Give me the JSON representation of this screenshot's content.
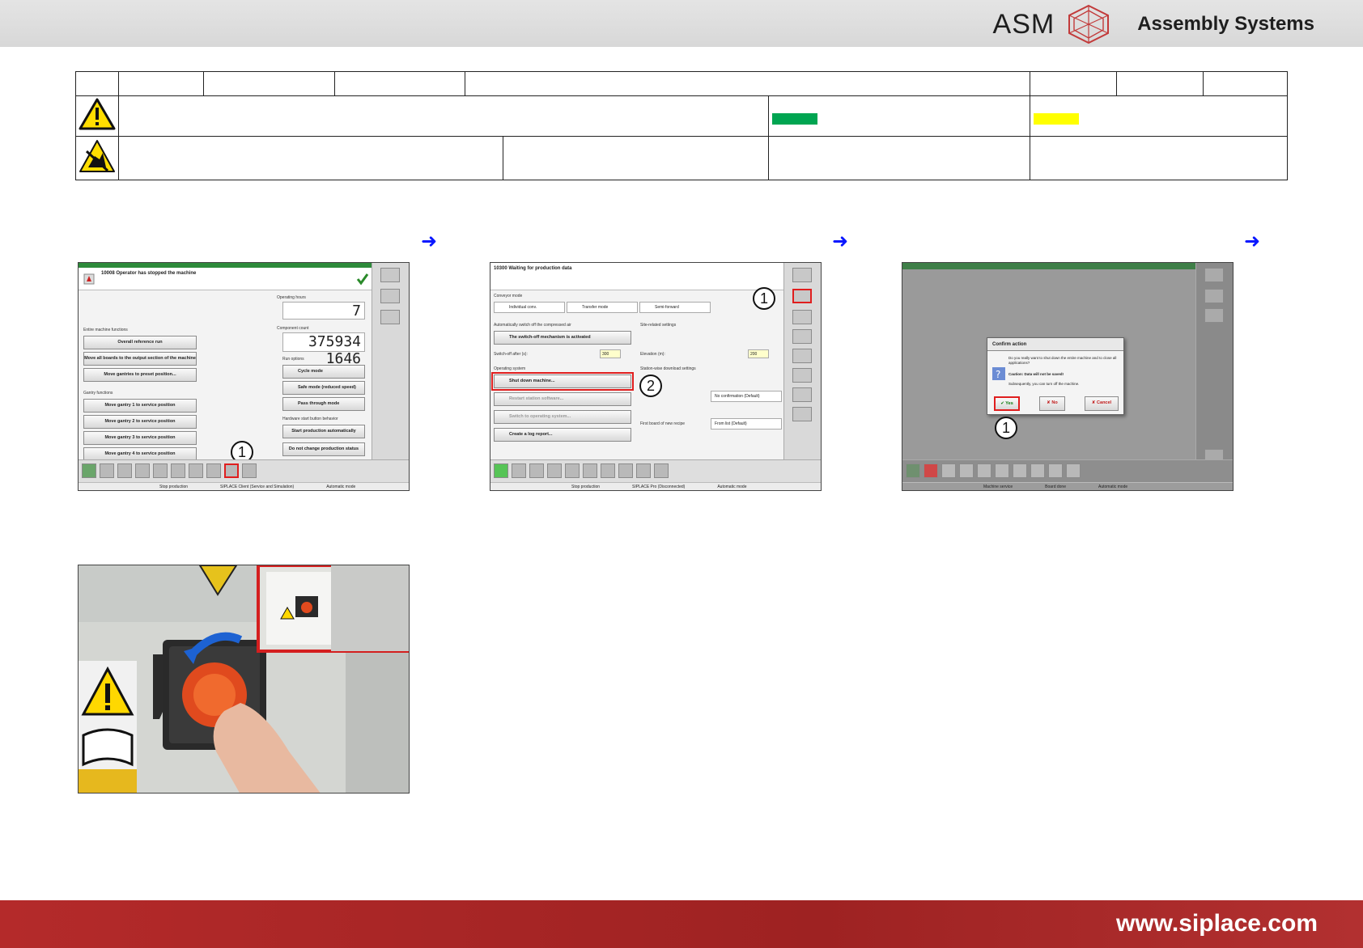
{
  "header": {
    "logo_text": "ASM",
    "logo_subtitle": "Assembly Systems"
  },
  "colors": {
    "green_swatch": "#00a551",
    "yellow_swatch": "#ffff00",
    "footer_red": "#a82626",
    "arrow_blue": "#0a18ff"
  },
  "icons": [
    "warning-triangle-icon",
    "esd-warning-icon",
    "right-arrow-icon",
    "asm-logo-icon"
  ],
  "screen1": {
    "header_text": "10008 Operator has stopped the machine",
    "operating_hours_label": "Operating hours",
    "operating_hours_value": "7",
    "component_count_label": "Component count",
    "component_count_value": "375934 1646",
    "gantry_section_label": "Entire machine functions",
    "buttons": [
      "Overall reference run",
      "Move all boards to the output section of the machine",
      "Move gantries to preset position..."
    ],
    "gantry_functions_label": "Gantry functions",
    "gantry_buttons": [
      "Move gantry 1 to service position",
      "Move gantry 2 to service position",
      "Move gantry 3 to service position",
      "Move gantry 4 to service position"
    ],
    "run_options_label": "Run options",
    "run_options": [
      "Cycle mode",
      "Safe mode (reduced speed)",
      "Pass through mode"
    ],
    "hardware_label": "Hardware start button behavior",
    "hardware_buttons": [
      "Start production automatically",
      "Do not change production status"
    ],
    "callout": "1",
    "status": [
      "Stop production",
      "SIPLACE Client (Service and Simulation)",
      "Automatic mode"
    ]
  },
  "screen2": {
    "header_text": "10300 Waiting for production data",
    "conveyor_label": "Conveyor mode",
    "conveyor_fields": [
      "Individual conv.",
      "Transfer mode",
      "Semi-forward"
    ],
    "compressed_air_label": "Automatically switch off the compressed air",
    "compressed_air_button": "The switch-off mechanism is activated",
    "switch_off_label": "Switch-off after (s):",
    "switch_off_value": "300",
    "site_label": "Site-related settings",
    "elevation_label": "Elevation (m):",
    "elevation_value": "200",
    "os_label": "Operating system",
    "os_buttons": [
      "Shut down machine...",
      "Restart station software...",
      "Switch to operating system...",
      "Create a log report..."
    ],
    "download_label": "Station-wise download settings",
    "download_fields": [
      "No confirmation (Default)",
      "From list (Default)"
    ],
    "first_board_label": "First board of new recipe",
    "callouts": [
      "1",
      "2"
    ],
    "status": [
      "Stop production",
      "SIPLACE Pro (Disconnected)",
      "Automatic mode"
    ]
  },
  "screen3": {
    "dialog_title": "Confirm action",
    "dialog_question": "Do you really want to shut down the entire machine and to close all applications?",
    "dialog_caution": "Caution: Data will not be saved!",
    "dialog_note": "Subsequently, you can turn off the machine.",
    "yes_label": "Yes",
    "no_label": "No",
    "cancel_label": "Cancel",
    "callout": "1",
    "status": [
      "Machine service",
      "Board done",
      "Automatic mode"
    ]
  },
  "footer": {
    "website": "www.siplace.com"
  }
}
